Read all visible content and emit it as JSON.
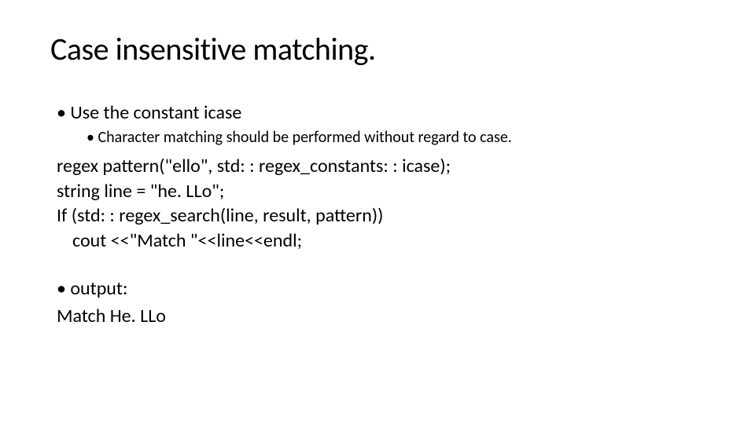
{
  "title": "Case insensitive matching.",
  "bullets": {
    "b1": "Use the constant icase",
    "b2": "Character matching should be performed without regard to case."
  },
  "code": {
    "l1": "regex pattern(\"ello\", std: : regex_constants: : icase);",
    "l2": "string line = \"he. LLo\";",
    "l3": "If (std: : regex_search(line, result, pattern))",
    "l4": "cout <<\"Match \"<<line<<endl;"
  },
  "output": {
    "label": "output:",
    "l1": "Match He. LLo"
  }
}
